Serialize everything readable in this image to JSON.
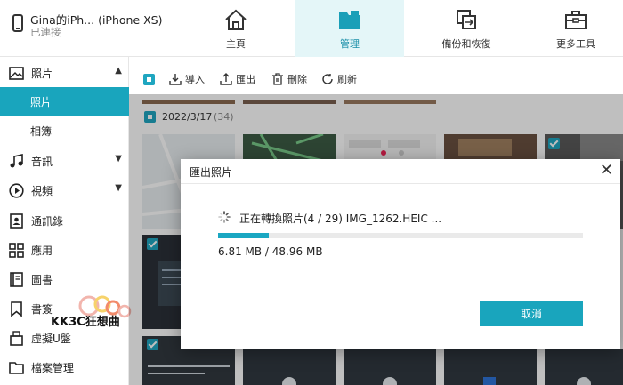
{
  "device": {
    "name": "Gina的iPh... (iPhone XS)",
    "status": "已連接"
  },
  "nav": [
    {
      "label": "主頁",
      "icon": "home-icon"
    },
    {
      "label": "管理",
      "icon": "folder-icon",
      "active": true
    },
    {
      "label": "備份和恢復",
      "icon": "backup-restore-icon"
    },
    {
      "label": "更多工具",
      "icon": "toolbox-icon"
    }
  ],
  "sidebar": {
    "photos": {
      "label": "照片",
      "icon": "image-icon",
      "expanded": true,
      "children": [
        {
          "label": "照片",
          "active": true
        },
        {
          "label": "相簿"
        }
      ]
    },
    "items": [
      {
        "label": "音訊",
        "icon": "music-icon",
        "has_children": true
      },
      {
        "label": "視頻",
        "icon": "play-icon",
        "has_children": true
      },
      {
        "label": "通訊錄",
        "icon": "contacts-icon"
      },
      {
        "label": "應用",
        "icon": "apps-icon"
      },
      {
        "label": "圖書",
        "icon": "book-icon"
      },
      {
        "label": "書簽",
        "icon": "bookmark-icon"
      },
      {
        "label": "虛擬U盤",
        "icon": "usb-drive-icon"
      },
      {
        "label": "檔案管理",
        "icon": "folder-outline-icon"
      }
    ]
  },
  "toolbar": {
    "import": "導入",
    "export": "匯出",
    "delete": "刪除",
    "refresh": "刷新"
  },
  "group": {
    "date": "2022/3/17",
    "count": "(34)"
  },
  "watermark": {
    "text": "KK3C狂想曲"
  },
  "dialog": {
    "title": "匯出照片",
    "message": "正在轉換照片(4 / 29) IMG_1262.HEIC ...",
    "progress": 0.14,
    "size": "6.81 MB / 48.96 MB",
    "cancel": "取消"
  },
  "colors": {
    "accent": "#19a5bd",
    "nav_active_bg": "#e4f6f8"
  }
}
